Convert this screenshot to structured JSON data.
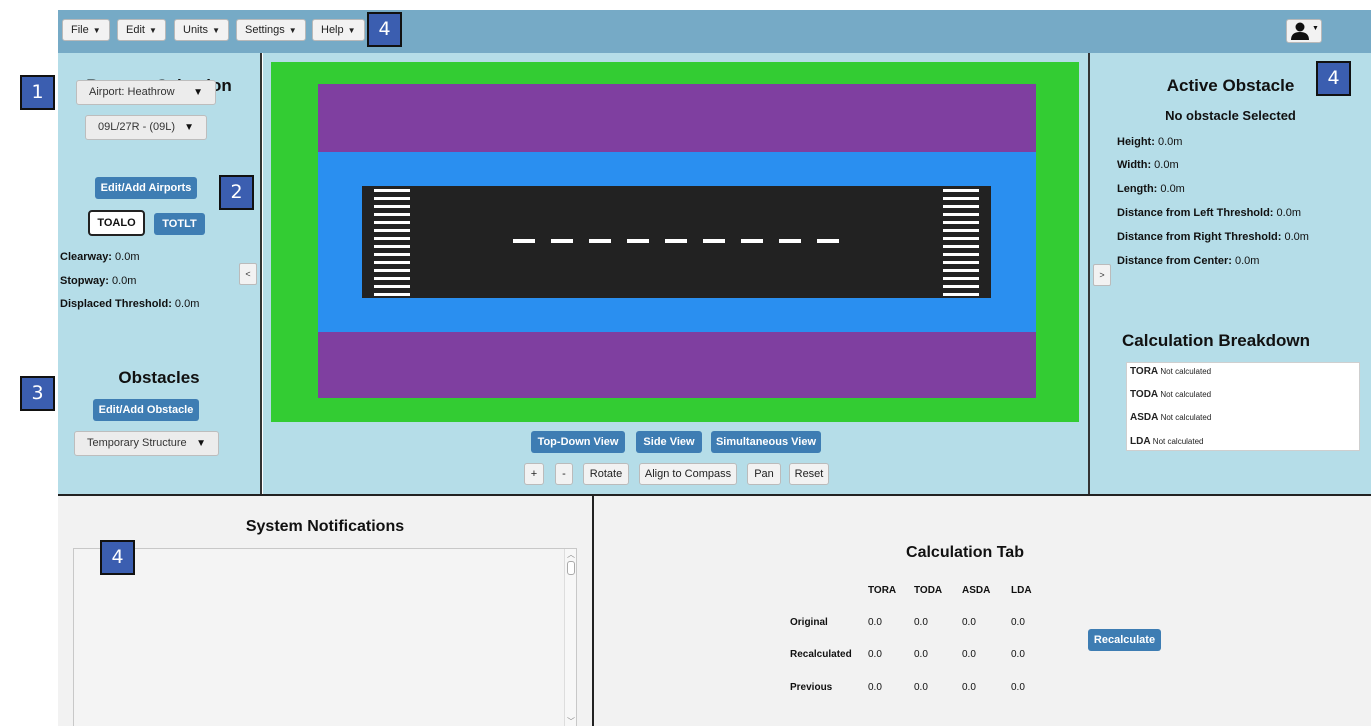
{
  "menu": {
    "items": [
      {
        "label": "File"
      },
      {
        "label": "Edit"
      },
      {
        "label": "Units"
      },
      {
        "label": "Settings"
      },
      {
        "label": "Help"
      }
    ]
  },
  "annotations": [
    "1",
    "2",
    "3",
    "4",
    "4",
    "4"
  ],
  "runway_selection": {
    "title": "Runway Selection",
    "airport_dropdown": "Airport: Heathrow",
    "runway_dropdown": "09L/27R -  (09L)",
    "edit_airports_label": "Edit/Add Airports",
    "toalo_label": "TOALO",
    "totlt_label": "TOTLT",
    "clearway_label": "Clearway:",
    "clearway_value": "0.0m",
    "stopway_label": "Stopway:",
    "stopway_value": "0.0m",
    "displaced_label": "Displaced Threshold:",
    "displaced_value": "0.0m"
  },
  "obstacles": {
    "title": "Obstacles",
    "edit_obstacle_label": "Edit/Add Obstacle",
    "type_dropdown": "Temporary Structure"
  },
  "collapse_left": "<",
  "collapse_right": ">",
  "views": {
    "top_down": "Top-Down View",
    "side": "Side View",
    "simultaneous": "Simultaneous View"
  },
  "controls": {
    "zoom_in": "+",
    "zoom_out": "-",
    "rotate": "Rotate",
    "align": "Align to Compass",
    "pan": "Pan",
    "reset": "Reset"
  },
  "colors": {
    "grass": "#33cc33",
    "strip": "#7f3fa0",
    "cleared_area": "#2a8ff0",
    "runway": "#222222"
  },
  "active_obstacle": {
    "title": "Active Obstacle",
    "subtitle": "No obstacle Selected",
    "height_label": "Height:",
    "height_value": "0.0m",
    "width_label": "Width:",
    "width_value": "0.0m",
    "length_label": "Length:",
    "length_value": "0.0m",
    "dist_left_label": "Distance from Left Threshold:",
    "dist_left_value": "0.0m",
    "dist_right_label": "Distance from Right Threshold:",
    "dist_right_value": "0.0m",
    "dist_center_label": "Distance from Center:",
    "dist_center_value": "0.0m"
  },
  "breakdown": {
    "title": "Calculation Breakdown",
    "rows": [
      {
        "name": "TORA",
        "text": "Not calculated"
      },
      {
        "name": "TODA",
        "text": "Not calculated"
      },
      {
        "name": "ASDA",
        "text": "Not calculated"
      },
      {
        "name": "LDA",
        "text": "Not calculated"
      }
    ]
  },
  "notifications": {
    "title": "System Notifications"
  },
  "calc_tab": {
    "title": "Calculation Tab",
    "columns": [
      "TORA",
      "TODA",
      "ASDA",
      "LDA"
    ],
    "rows": [
      {
        "label": "Original",
        "values": [
          "0.0",
          "0.0",
          "0.0",
          "0.0"
        ]
      },
      {
        "label": "Recalculated",
        "values": [
          "0.0",
          "0.0",
          "0.0",
          "0.0"
        ]
      },
      {
        "label": "Previous",
        "values": [
          "0.0",
          "0.0",
          "0.0",
          "0.0"
        ]
      }
    ],
    "recalculate_label": "Recalculate"
  }
}
